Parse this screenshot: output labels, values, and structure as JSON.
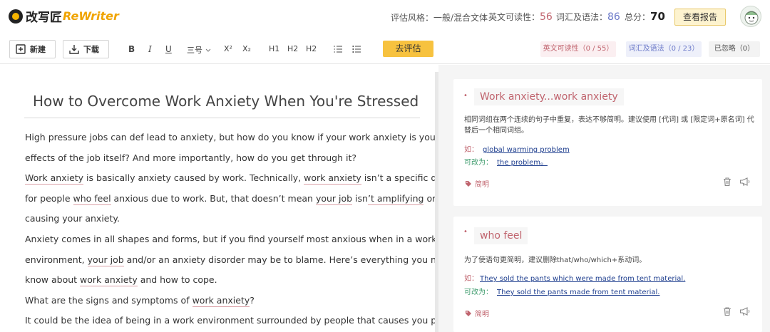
{
  "header": {
    "logo_cn": "改写匠",
    "logo_en": "ReWriter",
    "style_label": "评估风格：",
    "style_value": "一般/混合文体",
    "readability_label": "英文可读性：",
    "readability_score": "56",
    "grammar_label": "词汇及语法：",
    "grammar_score": "86",
    "total_label": "总分：",
    "total_score": "70",
    "report_button": "查看报告"
  },
  "toolbar": {
    "new_label": "新建",
    "download_label": "下载",
    "bold": "B",
    "italic": "I",
    "underline": "U",
    "font_size": "三号",
    "superscript": "X²",
    "subscript": "X₂",
    "h1": "H1",
    "h2a": "H2",
    "h2b": "H2",
    "evaluate_button": "去评估",
    "filter_readability": "英文可读性（0 / 55）",
    "filter_grammar": "词汇及语法（0 / 23）",
    "filter_ignored": "已忽略（0）"
  },
  "editor": {
    "title": "How to Overcome Work Anxiety When You're Stressed",
    "lines": [
      [
        {
          "t": "High pressure jobs can def lead to anxiety, but how do you know if your work anxiety is you or side"
        }
      ],
      [
        {
          "t": "effects of the job itself? And more importantly, how do you get through it?"
        }
      ],
      [
        {
          "t": "Work anxiety",
          "h": true
        },
        {
          "t": " is basically anxiety caused by work. Technically, "
        },
        {
          "t": "work anxiety",
          "h": true
        },
        {
          "t": " isn’t a specific diagnosis"
        }
      ],
      [
        {
          "t": "for people "
        },
        {
          "t": "who feel",
          "h": true
        },
        {
          "t": " anxious due to work. But, that doesn’t mean "
        },
        {
          "t": "your job",
          "h": true
        },
        {
          "t": " isn"
        },
        {
          "t": "’t amplifying",
          "h": true
        },
        {
          "t": " or"
        }
      ],
      [
        {
          "t": "causing your anxiety."
        }
      ],
      [
        {
          "t": "Anxiety comes in all shapes and forms, but if you find yourself most anxious when in a work"
        }
      ],
      [
        {
          "t": "environment, "
        },
        {
          "t": "your job",
          "h": true
        },
        {
          "t": " and/or an anxiety disorder may be to blame. Here’s everything you need to"
        }
      ],
      [
        {
          "t": "know about "
        },
        {
          "t": "work anxiety",
          "h": true
        },
        {
          "t": " and how to cope."
        }
      ],
      [
        {
          "t": "What are the signs and symptoms of "
        },
        {
          "t": "work anxiety",
          "h": true
        },
        {
          "t": "?"
        }
      ],
      [
        {
          "t": "It could be the idea of being in a work environment surrounded by people that causes you panic"
        }
      ]
    ]
  },
  "suggestions": [
    {
      "term": "Work anxiety...work anxiety",
      "description": "相同词组在两个连续的句子中重复，表达不够简明。建议使用 [代词] 或 [限定词+原名词] 代替后一个相同词组。",
      "example_label": "如：",
      "example": "global warming problem",
      "rewrite_label": "可改为：",
      "rewrite": "the problem。",
      "tag": "简明"
    },
    {
      "term": "who feel",
      "description": "为了使语句更简明，建议删除that/who/which+系动词。",
      "example_label": "如：",
      "example": "They sold the pants which were made from tent material.",
      "rewrite_label": "可改为：",
      "rewrite": "They sold the pants made from tent material.",
      "tag": "简明"
    }
  ],
  "icons": {
    "logo": "logo-icon",
    "new": "new-document-icon",
    "download": "download-icon",
    "list_ordered": "ordered-list-icon",
    "list_unordered": "unordered-list-icon",
    "tag": "tag-icon",
    "trash": "trash-icon",
    "megaphone": "megaphone-icon",
    "avatar": "avatar-icon"
  },
  "colors": {
    "accent_yellow": "#f7c23f",
    "readability_red": "#c0646e",
    "grammar_blue": "#6a78c8"
  }
}
